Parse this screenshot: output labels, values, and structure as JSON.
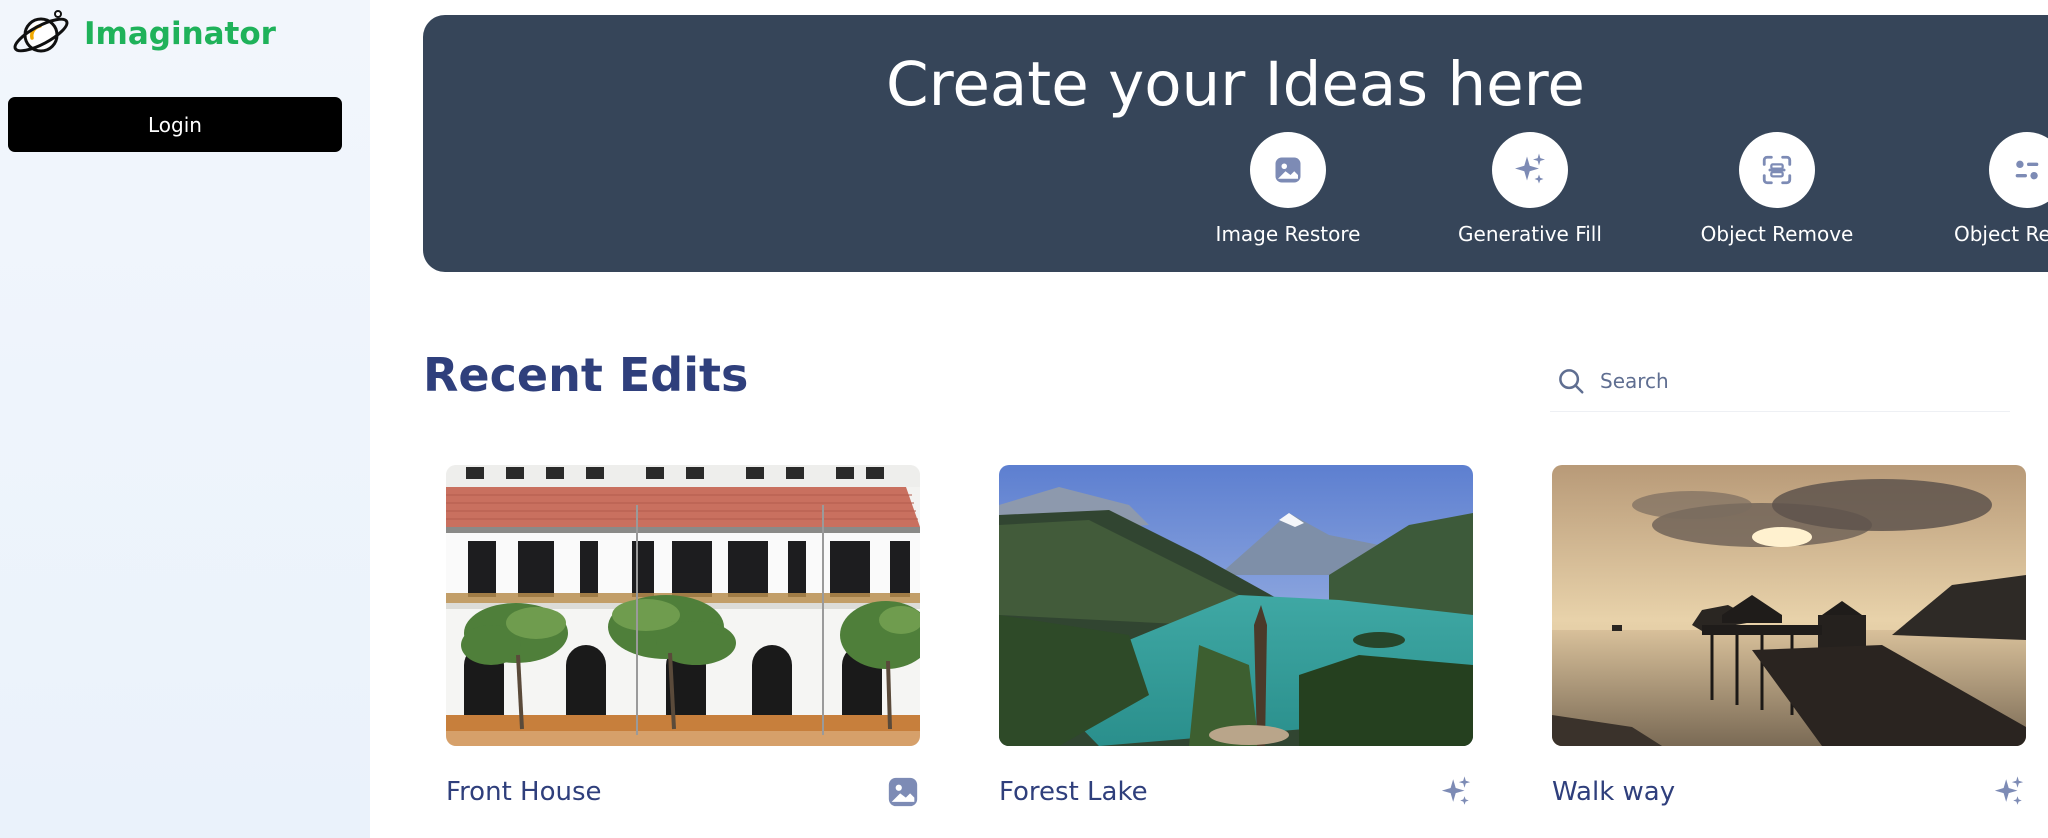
{
  "app": {
    "name": "Imaginator",
    "brand_color": "#1fb25a"
  },
  "sidebar": {
    "login_label": "Login"
  },
  "hero": {
    "title": "Create your Ideas here",
    "tools": [
      {
        "label": "Image Restore",
        "icon": "image-icon"
      },
      {
        "label": "Generative Fill",
        "icon": "sparkles-icon"
      },
      {
        "label": "Object Remove",
        "icon": "scan-icon"
      },
      {
        "label": "Object Recolor",
        "icon": "toggles-icon"
      }
    ]
  },
  "recent": {
    "title": "Recent Edits",
    "search_placeholder": "Search",
    "cards": [
      {
        "title": "Front House",
        "image": "building-facade-photo",
        "icon": "image-icon"
      },
      {
        "title": "Forest Lake",
        "image": "mountain-lake-photo",
        "icon": "sparkles-icon"
      },
      {
        "title": "Walk way",
        "image": "sunset-pier-photo",
        "icon": "sparkles-icon"
      }
    ]
  },
  "colors": {
    "hero_bg": "#364559",
    "heading": "#2f3f7c",
    "icon_muted": "#7d8bb5"
  }
}
